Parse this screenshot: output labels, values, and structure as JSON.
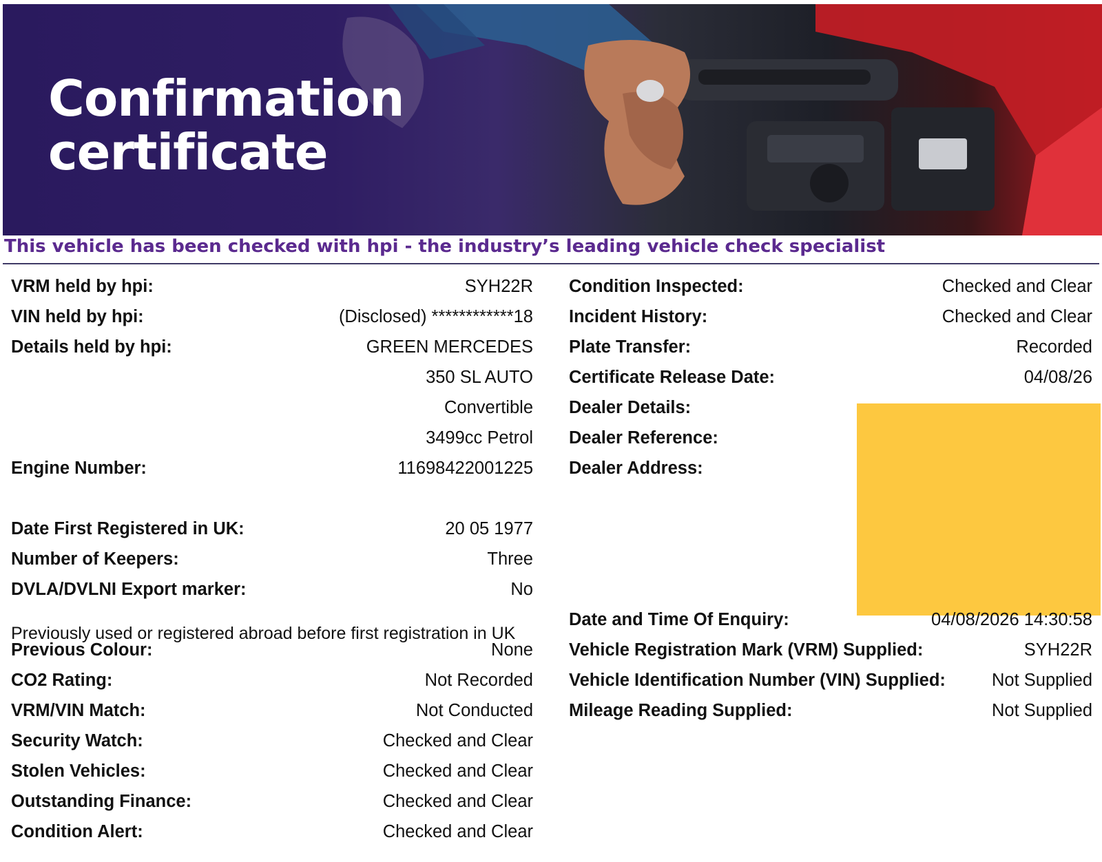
{
  "banner": {
    "title": "Confirmation\ncertificate"
  },
  "tagline": "This vehicle has been checked with hpi - the industry’s leading vehicle check specialist",
  "left_rows": [
    {
      "label": "VRM held by hpi:",
      "value": "SYH22R"
    },
    {
      "label": "VIN held by hpi:",
      "value": "(Disclosed) ************18"
    },
    {
      "label": "Details held by hpi:",
      "value": "GREEN MERCEDES"
    },
    {
      "label": "",
      "value": "350 SL AUTO"
    },
    {
      "label": "",
      "value": "Convertible"
    },
    {
      "label": "",
      "value": "3499cc Petrol"
    },
    {
      "label": "Engine Number:",
      "value": "11698422001225"
    },
    {
      "label": "Date First Registered in UK:",
      "value": "20 05 1977"
    },
    {
      "label": "Number of Keepers:",
      "value": "Three"
    },
    {
      "label": "DVLA/DVLNI Export marker:",
      "value": "No"
    },
    {
      "label": "Previous Colour:",
      "value": "None"
    },
    {
      "label": "CO2 Rating:",
      "value": "Not Recorded"
    },
    {
      "label": "VRM/VIN Match:",
      "value": "Not Conducted"
    },
    {
      "label": "Security Watch:",
      "value": "Checked and Clear"
    },
    {
      "label": "Stolen Vehicles:",
      "value": "Checked and Clear"
    },
    {
      "label": "Outstanding Finance:",
      "value": "Checked and Clear"
    },
    {
      "label": "Condition Alert:",
      "value": "Checked and Clear"
    }
  ],
  "abroad_note": "Previously used or registered abroad before first registration in UK",
  "right_rows": [
    {
      "label": "Condition Inspected:",
      "value": "Checked and Clear"
    },
    {
      "label": "Incident History:",
      "value": "Checked and Clear"
    },
    {
      "label": "Plate Transfer:",
      "value": "Recorded"
    },
    {
      "label": "Certificate Release Date:",
      "value": "04/08/26"
    },
    {
      "label": "Dealer Details:",
      "value": ""
    },
    {
      "label": "Dealer Reference:",
      "value": ""
    },
    {
      "label": "Dealer Address:",
      "value": ""
    },
    {
      "label": "Date and Time Of Enquiry:",
      "value": "04/08/2026 14:30:58"
    },
    {
      "label": "Vehicle Registration Mark (VRM) Supplied:",
      "value": "SYH22R"
    },
    {
      "label": "Vehicle Identification Number (VIN) Supplied:",
      "value": "Not Supplied"
    },
    {
      "label": "Mileage Reading Supplied:",
      "value": "Not Supplied"
    }
  ],
  "colors": {
    "banner_purple": "#2f1d63",
    "tagline_purple": "#5b2a8f",
    "redaction_yellow": "#fdc840",
    "car_red": "#b51a22"
  }
}
